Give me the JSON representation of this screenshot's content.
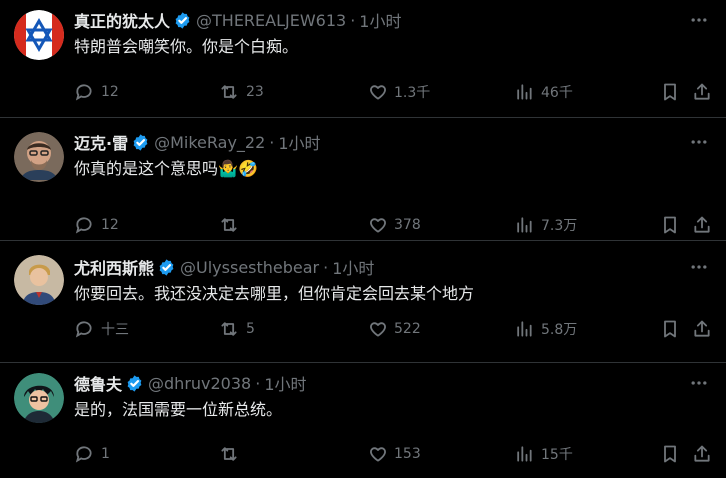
{
  "tweets": [
    {
      "name": "真正的犹太人",
      "handle": "@THEREALJEW613",
      "dot": "·",
      "time": "1小时",
      "text": "特朗普会嘲笑你。你是个白痴。",
      "replies": "12",
      "retweets": "23",
      "likes": "1.3千",
      "views": "46千"
    },
    {
      "name": "迈克·雷",
      "handle": "@MikeRay_22",
      "dot": "·",
      "time": "1小时",
      "text": "你真的是这个意思吗",
      "emoji": "🤷‍♂️🤣",
      "replies": "12",
      "retweets": "",
      "likes": "378",
      "views": "7.3万"
    },
    {
      "name": "尤利西斯熊",
      "handle": "@Ulyssesthebear",
      "dot": "·",
      "time": "1小时",
      "text": "你要回去。我还没决定去哪里，但你肯定会回去某个地方",
      "replies": "十三",
      "retweets": "5",
      "likes": "522",
      "views": "5.8万"
    },
    {
      "name": "德鲁夫",
      "handle": "@dhruv2038",
      "dot": "·",
      "time": "1小时",
      "text": "是的，法国需要一位新总统。",
      "replies": "1",
      "retweets": "",
      "likes": "153",
      "views": "15千"
    }
  ],
  "colors": {
    "background": "#000000",
    "text": "#e7e9ea",
    "muted": "#71767b",
    "verified": "#1d9bf0",
    "divider": "#2f3336"
  },
  "icons": [
    "more-icon",
    "reply-icon",
    "retweet-icon",
    "like-icon",
    "views-icon",
    "bookmark-icon",
    "share-icon",
    "verified-badge-icon"
  ]
}
